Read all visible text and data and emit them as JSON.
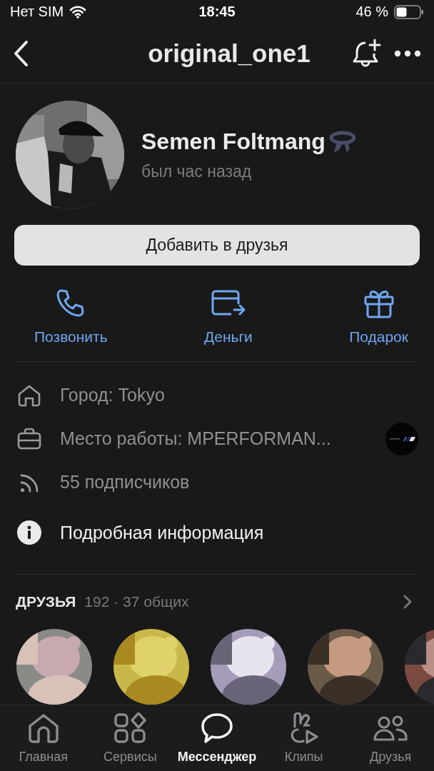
{
  "status_bar": {
    "carrier": "Нет SIM",
    "time": "18:45",
    "battery": "46 %"
  },
  "nav": {
    "title": "original_one1"
  },
  "profile": {
    "name": "Semen Foltmang",
    "last_seen": "был час назад",
    "has_badge": true
  },
  "primary_button": "Добавить в друзья",
  "actions": [
    {
      "kind": "phone",
      "label": "Позвонить"
    },
    {
      "kind": "money",
      "label": "Деньги"
    },
    {
      "kind": "gift",
      "label": "Подарок"
    }
  ],
  "info_rows": [
    {
      "kind": "home",
      "text": "Город: Tokyo",
      "highlight": false,
      "has_logo": false
    },
    {
      "kind": "work",
      "text": "Место работы: MPERFORMAN...",
      "highlight": false,
      "has_logo": true
    },
    {
      "kind": "followers",
      "text": "55 подписчиков",
      "highlight": false,
      "has_logo": false
    },
    {
      "kind": "info",
      "text": "Подробная информация",
      "highlight": true,
      "has_logo": false
    }
  ],
  "friends": {
    "title": "ДРУЗЬЯ",
    "count": "192 · 37 общих"
  },
  "tab_bar": [
    {
      "kind": "home",
      "label": "Главная",
      "selected": false
    },
    {
      "kind": "services",
      "label": "Сервисы",
      "selected": false
    },
    {
      "kind": "messenger",
      "label": "Мессенджер",
      "selected": true
    },
    {
      "kind": "clips",
      "label": "Клипы",
      "selected": false
    },
    {
      "kind": "friends",
      "label": "Друзья",
      "selected": false
    }
  ]
}
